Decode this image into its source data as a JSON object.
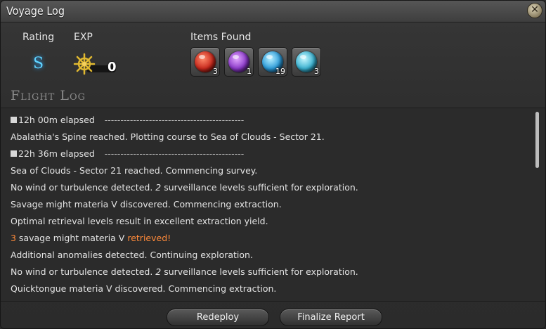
{
  "window": {
    "title": "Voyage Log",
    "close_glyph": "✕"
  },
  "summary": {
    "rating_label": "Rating",
    "rating_value": "S",
    "exp_label": "EXP",
    "exp_value": "0",
    "items_label": "Items Found"
  },
  "items": [
    {
      "icon": "red-materia-icon",
      "color": "#d8382a",
      "count": "3"
    },
    {
      "icon": "purple-materia-icon",
      "color": "#9a48d8",
      "count": "1"
    },
    {
      "icon": "blue-materia-icon",
      "color": "#3aa8e0",
      "count": "19"
    },
    {
      "icon": "teal-materia-icon",
      "color": "#48b8d8",
      "count": "3"
    }
  ],
  "flight_log": {
    "title": "Flight Log",
    "lines": [
      {
        "type": "marker",
        "elapsed": "12h 00m elapsed",
        "dashes": "--------------------------------------------"
      },
      {
        "type": "text",
        "text": "Abalathia's Spine reached. Plotting course to Sea of Clouds - Sector 21."
      },
      {
        "type": "marker",
        "elapsed": "22h 36m elapsed",
        "dashes": "--------------------------------------------"
      },
      {
        "type": "text",
        "text": "Sea of Clouds - Sector 21 reached. Commencing survey."
      },
      {
        "type": "italic",
        "pre": "No wind or turbulence detected. ",
        "em": "2",
        "post": " surveillance levels sufficient for exploration."
      },
      {
        "type": "text",
        "text": "Savage might materia V discovered. Commencing extraction."
      },
      {
        "type": "text",
        "text": "Optimal retrieval levels result in excellent extraction yield."
      },
      {
        "type": "highlight",
        "num": "3",
        "mid": " savage might materia V ",
        "hl": "retrieved!"
      },
      {
        "type": "text",
        "text": "Additional anomalies detected. Continuing exploration."
      },
      {
        "type": "italic",
        "pre": "No wind or turbulence detected. ",
        "em": "2",
        "post": " surveillance levels sufficient for exploration."
      },
      {
        "type": "text",
        "text": "Quicktongue materia V discovered. Commencing extraction."
      }
    ]
  },
  "buttons": {
    "redeploy": "Redeploy",
    "finalize": "Finalize Report"
  },
  "colors": {
    "highlight": "#ff8a3a",
    "rating": "#5fd3ff"
  }
}
